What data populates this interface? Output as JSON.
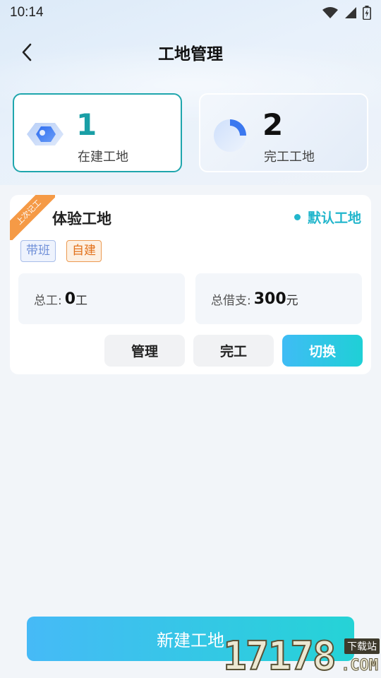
{
  "status_bar": {
    "time": "10:14",
    "icons": [
      "wifi-icon",
      "signal-icon",
      "battery-icon"
    ]
  },
  "nav": {
    "back_icon": "chevron-left-icon",
    "title": "工地管理"
  },
  "stats": {
    "in_progress": {
      "count": "1",
      "label": "在建工地"
    },
    "completed": {
      "count": "2",
      "label": "完工工地"
    }
  },
  "site": {
    "ribbon": "上次记工",
    "name": "体验工地",
    "default_label": "默认工地",
    "tags": [
      "带班",
      "自建"
    ],
    "total_work_label": "总工:",
    "total_work_value": "0",
    "total_work_unit": "工",
    "total_loan_label": "总借支:",
    "total_loan_value": "300",
    "total_loan_unit": "元",
    "buttons": {
      "manage": "管理",
      "finish": "完工",
      "switch": "切换"
    }
  },
  "new_button": "新建工地",
  "watermark": {
    "number": "17178",
    "tag": "下载站",
    "domain": ".COM"
  },
  "colors": {
    "accent_teal": "#1a9fa6",
    "accent_cyan": "#22b6cc",
    "ribbon_orange": "#f59a46",
    "gradient_start": "#46baf7",
    "gradient_end": "#25d3d6"
  }
}
